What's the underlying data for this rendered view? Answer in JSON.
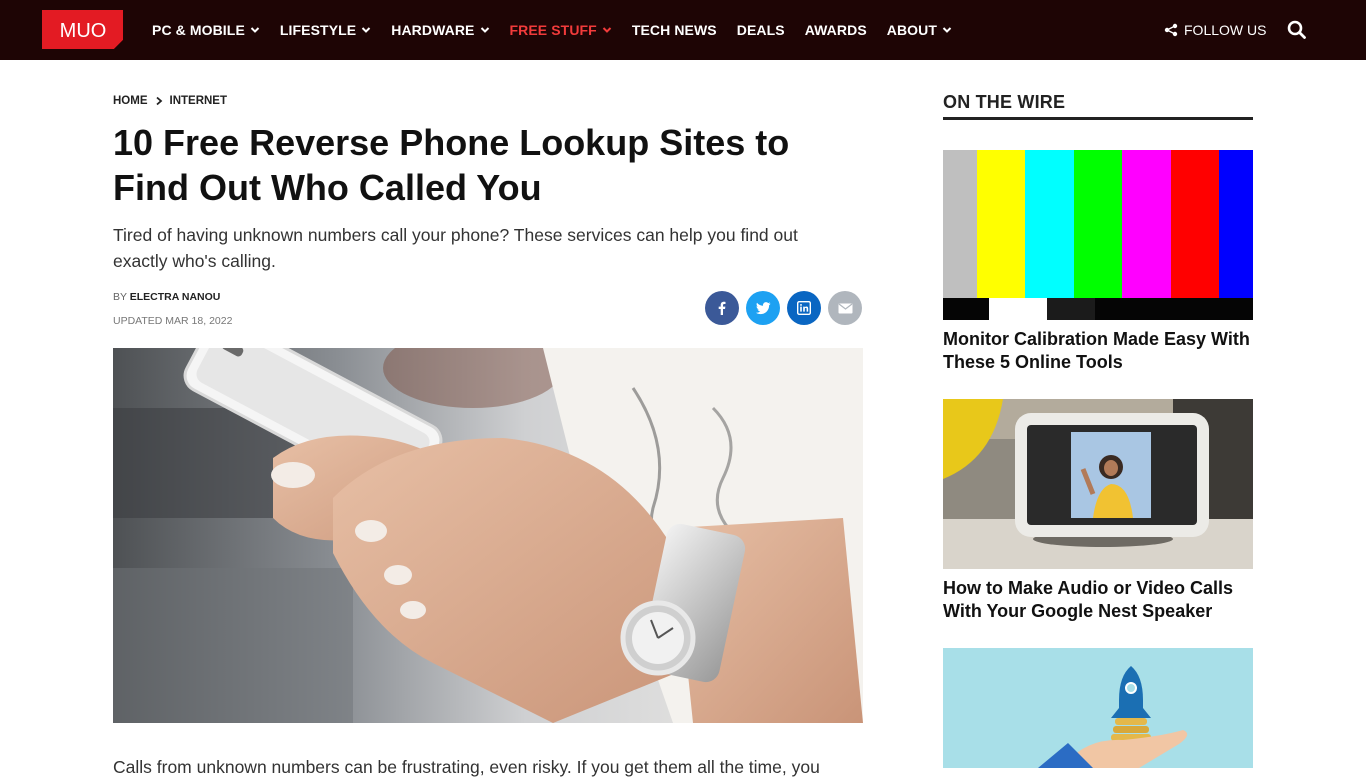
{
  "brand": {
    "logo_text": "MUO",
    "accent": "#e31b23",
    "nav_bg": "#1e0505"
  },
  "nav": {
    "items": [
      {
        "label": "PC & MOBILE",
        "dropdown": true,
        "active": false
      },
      {
        "label": "LIFESTYLE",
        "dropdown": true,
        "active": false
      },
      {
        "label": "HARDWARE",
        "dropdown": true,
        "active": false
      },
      {
        "label": "FREE STUFF",
        "dropdown": true,
        "active": true
      },
      {
        "label": "TECH NEWS",
        "dropdown": false,
        "active": false
      },
      {
        "label": "DEALS",
        "dropdown": false,
        "active": false
      },
      {
        "label": "AWARDS",
        "dropdown": false,
        "active": false
      },
      {
        "label": "ABOUT",
        "dropdown": true,
        "active": false
      }
    ],
    "follow_label": "FOLLOW US",
    "follow_icon": "share-icon",
    "search_icon": "search-icon"
  },
  "article": {
    "breadcrumb": [
      "HOME",
      "INTERNET"
    ],
    "title": "10 Free Reverse Phone Lookup Sites to Find Out Who Called You",
    "subtitle": "Tired of having unknown numbers call your phone? These services can help you find out exactly who's calling.",
    "byline_prefix": "BY",
    "author": "ELECTRA NANOU",
    "updated": "UPDATED MAR 18, 2022",
    "share": [
      {
        "name": "facebook",
        "icon": "facebook-icon",
        "color": "#3b5998"
      },
      {
        "name": "twitter",
        "icon": "twitter-icon",
        "color": "#1da1f2"
      },
      {
        "name": "linkedin",
        "icon": "linkedin-icon",
        "color": "#0a66c2"
      },
      {
        "name": "email",
        "icon": "email-icon",
        "color": "#b0b6bd"
      }
    ],
    "body_start": "Calls from unknown numbers can be frustrating, even risky. If you get them all the time, you"
  },
  "sidebar": {
    "heading": "ON THE WIRE",
    "cards": [
      {
        "title": "Monitor Calibration Made Easy With These 5 Online Tools",
        "image": "color-bars"
      },
      {
        "title": "How to Make Audio or Video Calls With Your Google Nest Speaker",
        "image": "nest-hub"
      },
      {
        "title": "",
        "image": "rocket-hand"
      }
    ]
  }
}
